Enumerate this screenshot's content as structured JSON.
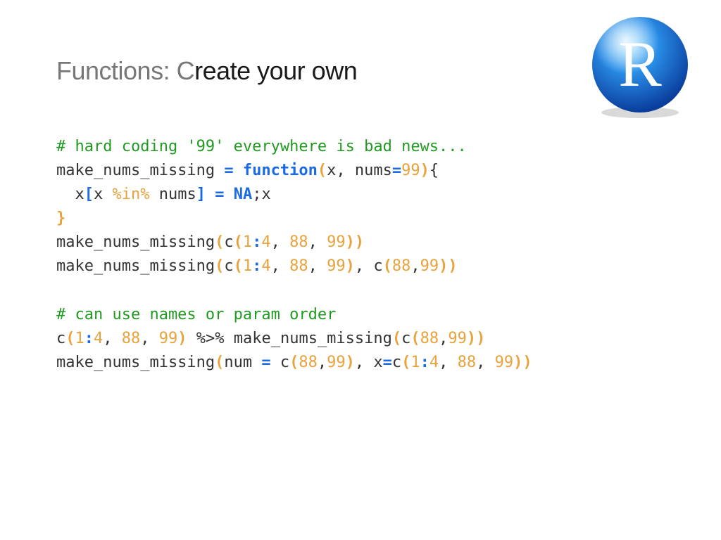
{
  "title": {
    "prefix": "Functions: C",
    "emph": "reate your own"
  },
  "logo": {
    "letter": "R"
  },
  "code": {
    "line1_comment": "# hard coding '99' everywhere is bad news...",
    "line2_fn": "make_nums_missing",
    "line2_eq": " = ",
    "line2_kw": "function",
    "line2_open": "(",
    "line2_args_a": "x, nums",
    "line2_eq2": "=",
    "line2_num": "99",
    "line2_close": ")",
    "line2_brace": "{",
    "line3_indent": "  x",
    "line3_lbr": "[",
    "line3_x": "x ",
    "line3_in": "%in%",
    "line3_nums": " nums",
    "line3_rbr": "]",
    "line3_sp": " ",
    "line3_eq": "=",
    "line3_sp2": " ",
    "line3_na": "NA",
    "line3_tail": ";x",
    "line4_brace": "}",
    "line5_fn": "make_nums_missing",
    "line5_o1": "(",
    "line5_c": "c",
    "line5_o2": "(",
    "line5_n1": "1",
    "line5_colon": ":",
    "line5_n4": "4",
    "line5_comma": ", ",
    "line5_n88": "88",
    "line5_comma2": ", ",
    "line5_n99": "99",
    "line5_c2": ")",
    "line5_c1": ")",
    "line6_fn": "make_nums_missing",
    "line6_o1": "(",
    "line6_c": "c",
    "line6_o2": "(",
    "line6_n1": "1",
    "line6_colon": ":",
    "line6_n4": "4",
    "line6_comma": ", ",
    "line6_n88": "88",
    "line6_comma2": ", ",
    "line6_n99": "99",
    "line6_c2": ")",
    "line6_comma3": ", ",
    "line6_cb": "c",
    "line6_o3": "(",
    "line6_n88b": "88",
    "line6_comma4": ",",
    "line6_n99b": "99",
    "line6_c3": ")",
    "line6_c1": ")",
    "line8_comment": "# can use names or param order",
    "line9_c": "c",
    "line9_o1": "(",
    "line9_n1": "1",
    "line9_colon": ":",
    "line9_n4": "4",
    "line9_comma": ", ",
    "line9_n88": "88",
    "line9_comma2": ", ",
    "line9_n99": "99",
    "line9_c1": ")",
    "line9_pipe": " %>% ",
    "line9_fn": "make_nums_missing",
    "line9_o2": "(",
    "line9_cb": "c",
    "line9_o3": "(",
    "line9_n88b": "88",
    "line9_comma3": ",",
    "line9_n99b": "99",
    "line9_c3": ")",
    "line9_c2": ")",
    "line10_fn": "make_nums_missing",
    "line10_o1": "(",
    "line10_num_lbl": "num ",
    "line10_eq": "=",
    "line10_sp": " ",
    "line10_c": "c",
    "line10_o2": "(",
    "line10_n88": "88",
    "line10_comma": ",",
    "line10_n99": "99",
    "line10_c2": ")",
    "line10_comma2": ", x",
    "line10_eq2": "=",
    "line10_cb": "c",
    "line10_o3": "(",
    "line10_n1": "1",
    "line10_colon": ":",
    "line10_n4": "4",
    "line10_comma3": ", ",
    "line10_n88b": "88",
    "line10_comma4": ", ",
    "line10_n99b": "99",
    "line10_c3": ")",
    "line10_c1": ")"
  }
}
